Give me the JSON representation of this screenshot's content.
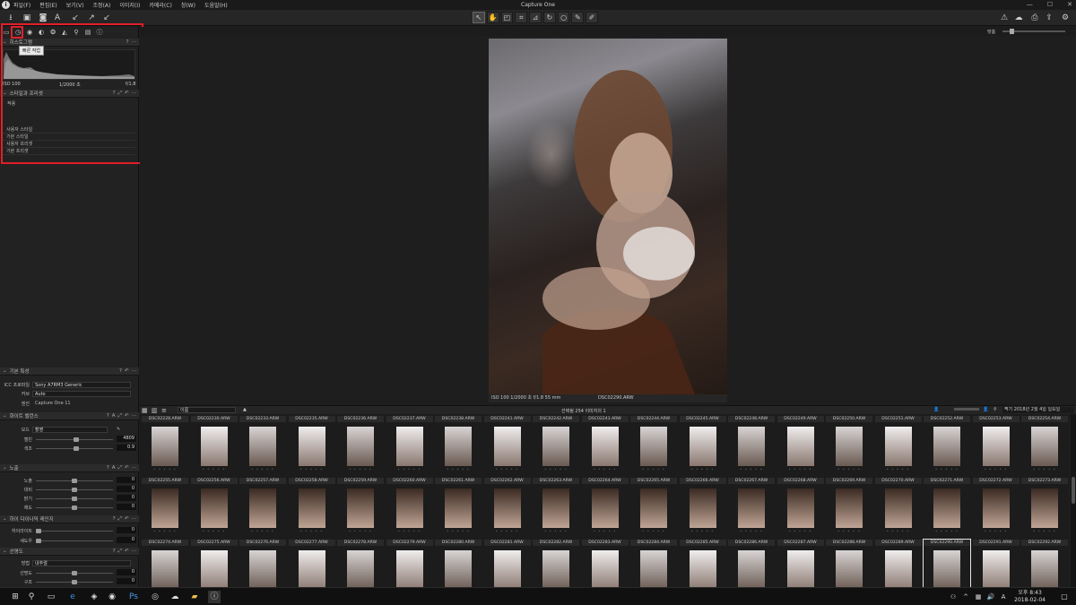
{
  "app": {
    "title": "Capture One"
  },
  "menu": [
    "파일(F)",
    "편집(E)",
    "보기(V)",
    "조정(A)",
    "이미지(I)",
    "카메라(C)",
    "창(W)",
    "도움말(H)"
  ],
  "histogram": {
    "title": "히스토그램",
    "iso": "ISO 100",
    "shutter": "1/2000 초",
    "aperture": "f/1.8",
    "tooltip": "빠른 작업"
  },
  "styles": {
    "title": "스타일과 프리셋",
    "apply_label": "적용",
    "items": [
      "사용자 스타일",
      "기본 스타일",
      "사용자 프리셋",
      "기본 프리셋"
    ]
  },
  "base": {
    "title": "기본 특성",
    "icc_label": "ICC 프로파일",
    "icc_value": "Sony A7RM3 Generic",
    "curve_label": "커브",
    "curve_value": "Auto",
    "engine_label": "엔진",
    "engine_value": "Capture One 11"
  },
  "wb": {
    "title": "화이트 밸런스",
    "mode_label": "모드",
    "mode_value": "촬영",
    "kelvin_label": "켈빈",
    "kelvin_value": "4809",
    "tint_label": "색조",
    "tint_value": "0.9"
  },
  "exposure": {
    "title": "노출",
    "rows": [
      {
        "label": "노출",
        "value": "0"
      },
      {
        "label": "대비",
        "value": "0"
      },
      {
        "label": "밝기",
        "value": "0"
      },
      {
        "label": "채도",
        "value": "0"
      }
    ]
  },
  "hdr": {
    "title": "하이 다이나믹 레인지",
    "rows": [
      {
        "label": "하이라이트",
        "value": "0"
      },
      {
        "label": "섀도우",
        "value": "0"
      }
    ]
  },
  "clarity": {
    "title": "선명도",
    "method_label": "방법",
    "method_value": "내추럴",
    "rows": [
      {
        "label": "선명도",
        "value": "0"
      },
      {
        "label": "구조",
        "value": "0"
      }
    ]
  },
  "viewer": {
    "caption": "ISO 100  1/2000 초  f/1.8  55 mm",
    "filename": "DSC02290.ARW",
    "fit_label": "맞춤"
  },
  "browser": {
    "sort": "이름",
    "count": "선택됨 254 이미지의 1",
    "search": "찍기 2018년 2월 4일 일요일",
    "row1": [
      "DSC02228.ARW",
      "DSC02230.ARW",
      "DSC02233.ARW",
      "DSC02235.ARW",
      "DSC02236.ARW",
      "DSC02237.ARW",
      "DSC02238.ARW",
      "DSC02241.ARW",
      "DSC02242.ARW",
      "DSC02243.ARW",
      "DSC02244.ARW",
      "DSC02245.ARW",
      "DSC02248.ARW",
      "DSC02249.ARW",
      "DSC02250.ARW",
      "DSC02251.ARW",
      "DSC02252.ARW",
      "DSC02253.ARW",
      "DSC02254.ARW"
    ],
    "row2": [
      "DSC02255.ARW",
      "DSC02256.ARW",
      "DSC02257.ARW",
      "DSC02258.ARW",
      "DSC02259.ARW",
      "DSC02260.ARW",
      "DSC02261.ARW",
      "DSC02262.ARW",
      "DSC02263.ARW",
      "DSC02264.ARW",
      "DSC02265.ARW",
      "DSC02266.ARW",
      "DSC02267.ARW",
      "DSC02268.ARW",
      "DSC02269.ARW",
      "DSC02270.ARW",
      "DSC02271.ARW",
      "DSC02272.ARW",
      "DSC02273.ARW"
    ],
    "row3": [
      "DSC02274.ARW",
      "DSC02275.ARW",
      "DSC02276.ARW",
      "DSC02277.ARW",
      "DSC02278.ARW",
      "DSC02279.ARW",
      "DSC02280.ARW",
      "DSC02281.ARW",
      "DSC02282.ARW",
      "DSC02283.ARW",
      "DSC02284.ARW",
      "DSC02285.ARW",
      "DSC02286.ARW",
      "DSC02287.ARW",
      "DSC02288.ARW",
      "DSC02289.ARW",
      "DSC02290.ARW",
      "DSC02291.ARW",
      "DSC02292.ARW"
    ]
  },
  "taskbar": {
    "time": "오후 8:43",
    "date": "2018-02-04"
  }
}
